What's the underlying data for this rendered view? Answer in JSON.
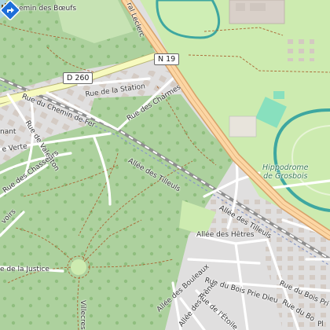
{
  "map": {
    "road_shields": {
      "n19": "N 19",
      "d260": "D 260"
    },
    "street_labels": {
      "chemin_des_boeufs": "Chemin des Bœufs",
      "leclerc": "ral Leclerc",
      "rue_station": "Rue de la Station",
      "rue_chemin_fer": "Rue du Chemin de Fer",
      "rue_charmes": "Rue des Charmes",
      "nant": "nant",
      "rue_valenton": "Rue de Valenton",
      "e_verte": "e Verte",
      "rue_chasseurs": "Rue des Chasseurs",
      "voirs": "voirs",
      "allee_tilleuls_1": "Allée des Tilleuls",
      "allee_tilleuls_2": "Allée des Tilleuls",
      "allee_hetres": "Allée des Hêtres",
      "rue_justice": "e de la Justice",
      "allee_bouleaux": "Allée des Bouleaux",
      "rue_bois_prie_dieu": "Rue du Bois Prie Dieu",
      "rue_bois_pri": "Rue du Bois Pri",
      "allee_freres": "Allée des Frênes",
      "rue_etoile": "Rue de l'Étoile",
      "rue_bo": "Rue du Bo",
      "villecresnes": "Villecres",
      "pl": "Pl"
    },
    "poi": {
      "hippodrome_line1": "Hippodrome",
      "hippodrome_line2": "de Grosbois"
    },
    "icons": {
      "marker": "location-pin-icon",
      "castle": "castle-icon"
    },
    "colors": {
      "forest": "#add19e",
      "grass": "#cdebb0",
      "residential": "#e0dfdf",
      "buildings": "#d9d0c9",
      "primary_road": "#fcd6a4",
      "primary_casing": "#d7a26a",
      "secondary_road": "#f7fabf",
      "secondary_casing": "#b8b577",
      "railway": "#707070",
      "track": "#aa6633",
      "water": "#aad3df",
      "marker": "#1e6fd9"
    }
  }
}
